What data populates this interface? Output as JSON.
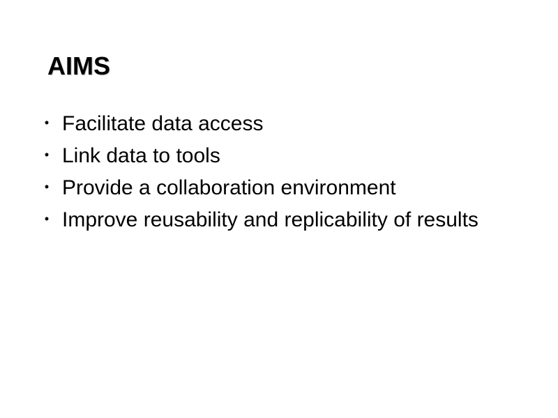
{
  "slide": {
    "title": "AIMS",
    "bullet_symbol": "•",
    "bullets": [
      "Facilitate data access",
      "Link data to tools",
      "Provide a collaboration environment",
      "Improve reusability and replicability of results"
    ]
  },
  "colors": {
    "background": "#ffffff",
    "text": "#000000"
  }
}
